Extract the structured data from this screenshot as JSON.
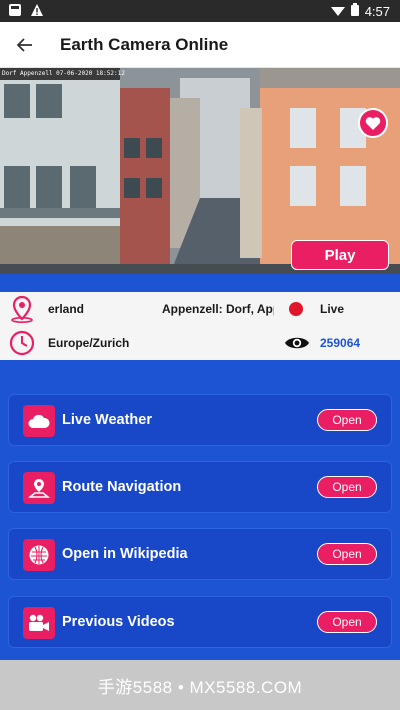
{
  "status_bar": {
    "time": "4:57",
    "icons": [
      "notification-icon",
      "alert-icon",
      "wifi-icon",
      "battery-icon"
    ]
  },
  "app_bar": {
    "title": "Earth Camera Online",
    "back_icon": "arrow-left-icon"
  },
  "camera": {
    "stamp": "Dorf Appenzell 07-06-2020 18:52:12",
    "play_label": "Play",
    "favorite_icon": "heart-icon"
  },
  "info": {
    "country": "erland",
    "place": "Appenzell: Dorf, Appenzell",
    "live_label": "Live",
    "timezone": "Europe/Zurich",
    "views": "259064",
    "view_color": "#1c54d4"
  },
  "menu": [
    {
      "label": "Live Weather",
      "icon": "cloud-icon",
      "button": "Open"
    },
    {
      "label": "Route Navigation",
      "icon": "map-route-icon",
      "button": "Open"
    },
    {
      "label": "Open in Wikipedia",
      "icon": "wikipedia-icon",
      "button": "Open"
    },
    {
      "label": "Previous Videos",
      "icon": "video-camera-icon",
      "button": "Open"
    }
  ],
  "watermark": "手游5588 • MX5588.COM",
  "colors": {
    "accent": "#ea1e63",
    "primary": "#1c54d4"
  }
}
